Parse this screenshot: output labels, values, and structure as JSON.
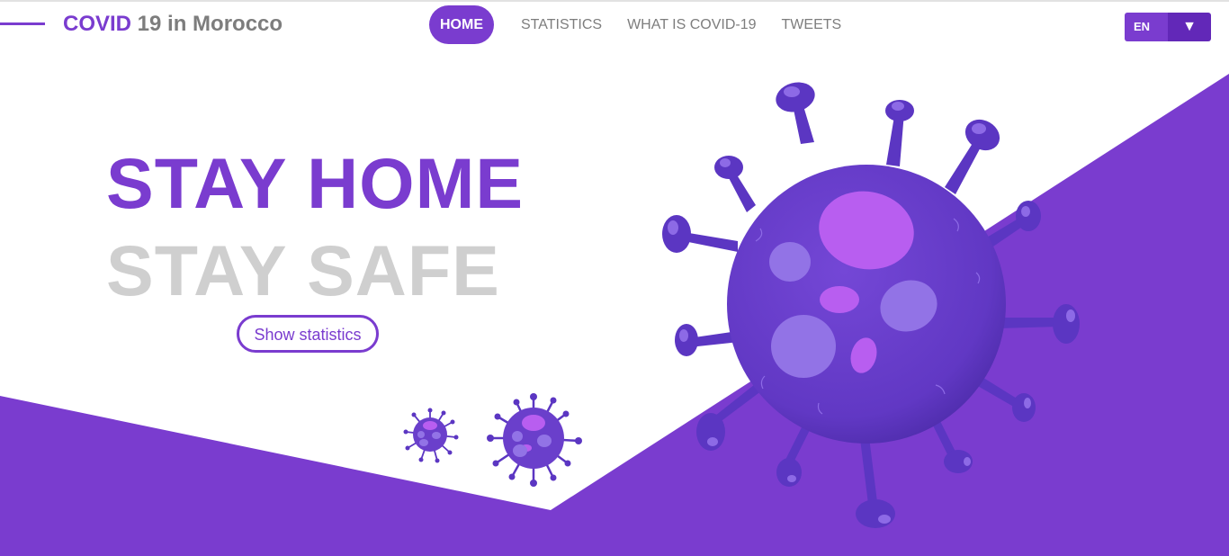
{
  "header": {
    "brand_part1": "COVID",
    "brand_part2": " 19 in Morocco"
  },
  "nav": {
    "items": [
      {
        "label": "HOME",
        "active": true
      },
      {
        "label": "STATISTICS",
        "active": false
      },
      {
        "label": "WHAT IS COVID-19",
        "active": false
      },
      {
        "label": "TWEETS",
        "active": false
      }
    ]
  },
  "language": {
    "selected": "EN",
    "caret": "▼"
  },
  "hero": {
    "line1": "STAY HOME",
    "line2": "STAY SAFE",
    "cta_label": "Show statistics"
  },
  "colors": {
    "accent": "#7a3ccf",
    "accent_dark": "#6228b8",
    "muted_text": "#7d7d7d",
    "headline_grey": "#cfcfcf",
    "virus_body": "#6a3fcb",
    "virus_spot": "#b85ef0"
  },
  "icons": [
    "virus-illustration-large",
    "virus-illustration-medium",
    "virus-illustration-small"
  ]
}
